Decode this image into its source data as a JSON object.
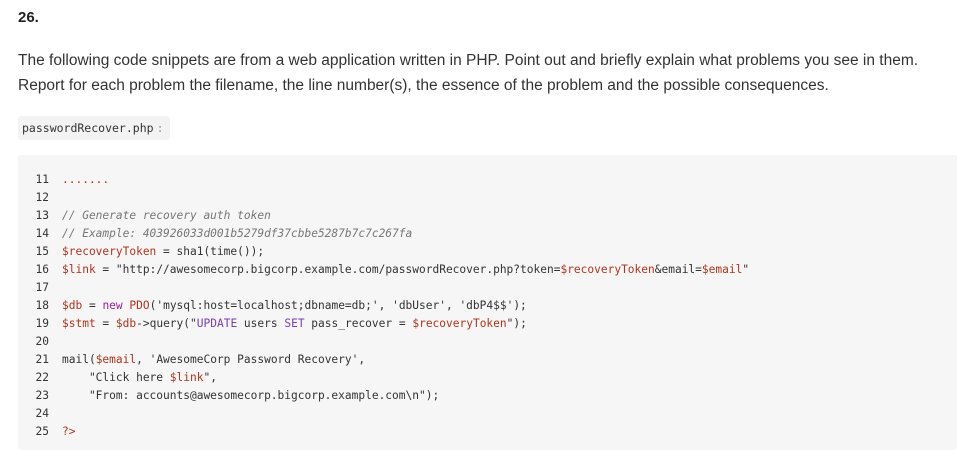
{
  "question": {
    "number": "26.",
    "intro": "The following code snippets are from a web application written in PHP. Point out and briefly explain what problems you see in them. Report for each problem the filename, the line number(s), the essence of the problem and the possible consequences."
  },
  "file": {
    "name": "passwordRecover.php",
    "separator": ":"
  },
  "code": {
    "line_numbers": [
      "11",
      "12",
      "13",
      "14",
      "15",
      "16",
      "17",
      "18",
      "19",
      "20",
      "21",
      "22",
      "23",
      "24",
      "25"
    ],
    "l11": ".......",
    "l13": "// Generate recovery auth token",
    "l14": "// Example: 403926033d001b5279df37cbbe5287b7c7c267fa",
    "l15_var": "$recoveryToken",
    "l15_rest": " = sha1(time());",
    "l16_var": "$link",
    "l16_eq": " = ",
    "l16_str1": "\"http://awesomecorp.bigcorp.example.com/passwordRecover.php?token=",
    "l16_var2": "$recoveryToken",
    "l16_str2": "&email=",
    "l16_var3": "$email",
    "l16_str3": "\"",
    "l18_var": "$db",
    "l18_eq": " = ",
    "l18_kw": "new",
    "l18_cls": " PDO",
    "l18_args": "('mysql:host=localhost;dbname=db;', 'dbUser', 'dbP4$$');",
    "l19_var": "$stmt",
    "l19_eq": " = ",
    "l19_var2": "$db",
    "l19_call": "->query(",
    "l19_str1": "\"",
    "l19_sql1": "UPDATE",
    "l19_str2": " users ",
    "l19_sql2": "SET",
    "l19_str3": " pass_recover = ",
    "l19_var3": "$recoveryToken",
    "l19_str4": "\"",
    "l19_end": ");",
    "l21_fn": "mail(",
    "l21_var": "$email",
    "l21_rest": ", 'AwesomeCorp Password Recovery',",
    "l22_str1": "    \"Click here ",
    "l22_var": "$link",
    "l22_str2": "\",",
    "l23": "    \"From: accounts@awesomecorp.bigcorp.example.com\\n\");",
    "l25": "?>"
  }
}
